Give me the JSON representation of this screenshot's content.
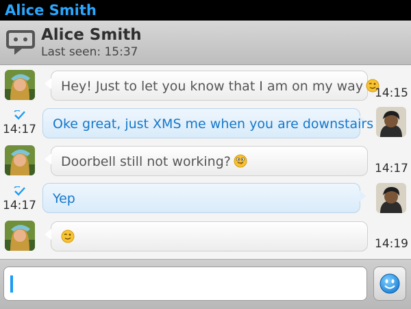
{
  "app": {
    "title": "Alice Smith"
  },
  "header": {
    "name": "Alice Smith",
    "last_seen": "Last seen: 15:37",
    "icon": "chat-bubble-icon"
  },
  "messages": [
    {
      "direction": "in",
      "text": "Hey! Just to let you know that I am on my way",
      "emoji": "winking-smiley",
      "time": "14:15"
    },
    {
      "direction": "out",
      "text": "Oke great, just XMS me when you are downstairs",
      "emoji": "",
      "time": "14:17",
      "status": "delivered-check"
    },
    {
      "direction": "in",
      "text": "Doorbell still not working?",
      "emoji": "tongue-out-smiley",
      "time": "14:17"
    },
    {
      "direction": "out",
      "text": "Yep",
      "emoji": "",
      "time": "14:17",
      "status": "delivered-check"
    },
    {
      "direction": "in",
      "text": "",
      "emoji": "winking-smiley",
      "time": "14:19"
    }
  ],
  "composer": {
    "value": "",
    "emoji_button_icon": "smiley-icon"
  },
  "colors": {
    "accent": "#1a9bf5",
    "outgoing_text": "#1477c9",
    "title": "#2aa7ff"
  }
}
